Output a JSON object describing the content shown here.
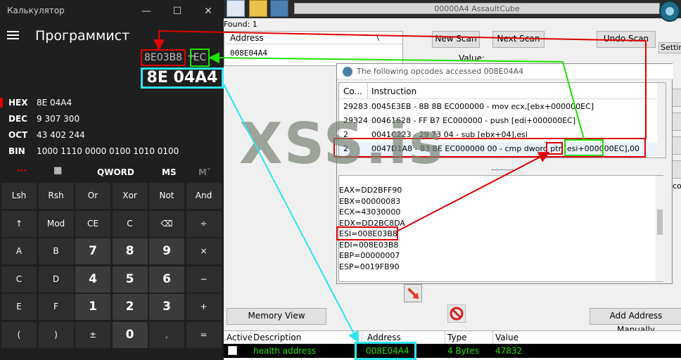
{
  "calculator": {
    "window_title": "Калькулятор",
    "mode_title": "Программист",
    "expression_operand": "8E03B8",
    "expression_operator": "+",
    "expression_offset": "EC",
    "display_value": "8E 04A4",
    "radix": [
      {
        "label": "HEX",
        "value": "8E 04A4"
      },
      {
        "label": "DEC",
        "value": "9 307 300"
      },
      {
        "label": "OCT",
        "value": "43 402 244"
      },
      {
        "label": "BIN",
        "value": "1000 1110 0000 0100 1010 0100"
      }
    ],
    "toolbar": {
      "word_size": "QWORD",
      "memory_store": "MS",
      "memory_list": "M˅"
    },
    "keys": [
      [
        "Lsh",
        "Rsh",
        "Or",
        "Xor",
        "Not",
        "And"
      ],
      [
        "↑",
        "Mod",
        "CE",
        "C",
        "⌫",
        "÷"
      ],
      [
        "A",
        "B",
        "7",
        "8",
        "9",
        "×"
      ],
      [
        "C",
        "D",
        "4",
        "5",
        "6",
        "−"
      ],
      [
        "E",
        "F",
        "1",
        "2",
        "3",
        "+"
      ],
      [
        "(",
        ")",
        "±",
        "0",
        ",",
        "="
      ]
    ]
  },
  "cheat_engine": {
    "process_title": "00000A4 AssaultCube",
    "found_label": "Found: 1",
    "address_header": "Address",
    "address_value": "008E04A4",
    "new_scan": "New Scan",
    "next_scan": "Next Scan",
    "undo_scan": "Undo Scan",
    "value_label": "Value:",
    "settings": "Settin",
    "memory_view": "Memory View",
    "add_address_manually": "Add Address Manually",
    "side_label": "co",
    "opcode_window": {
      "title": "The following opcodes accessed 008E04A4",
      "col_count": "Co...",
      "col_instruction": "Instruction",
      "rows": [
        {
          "count": "29283",
          "instruction": "0045E3EB - 8B 8B EC000000 - mov ecx,[ebx+000000EC]"
        },
        {
          "count": "29324",
          "instruction": "00461628 - FF B7 EC000000 - push [edi+000000EC]"
        },
        {
          "count": "2",
          "instruction": "0041C223 - 29 73 04 - sub [ebx+04],esi"
        },
        {
          "count": "2",
          "instruction": "0047D1A8 - 83 BE EC000000 00 - cmp dword ptr [esi+000000EC],00"
        }
      ],
      "registers": [
        "EAX=DD2BFF90",
        "EBX=00000083",
        "ECX=43030000",
        "EDX=DD2BC8DA",
        "ESI=008E03B8",
        "EDI=008E03B8",
        "EBP=00000007",
        "ESP=0019FB90"
      ]
    },
    "table": {
      "headers": [
        "Active",
        "Description",
        "Address",
        "Type",
        "Value"
      ],
      "row": {
        "description": "health address",
        "address": "008E04A4",
        "type": "4 Bytes",
        "value": "47832"
      }
    }
  },
  "watermark": "XSS.is",
  "colors": {
    "annotation_red": "#e00000",
    "annotation_green": "#1fe000",
    "annotation_cyan": "#2ee6f0",
    "table_row_text": "#22e000"
  }
}
